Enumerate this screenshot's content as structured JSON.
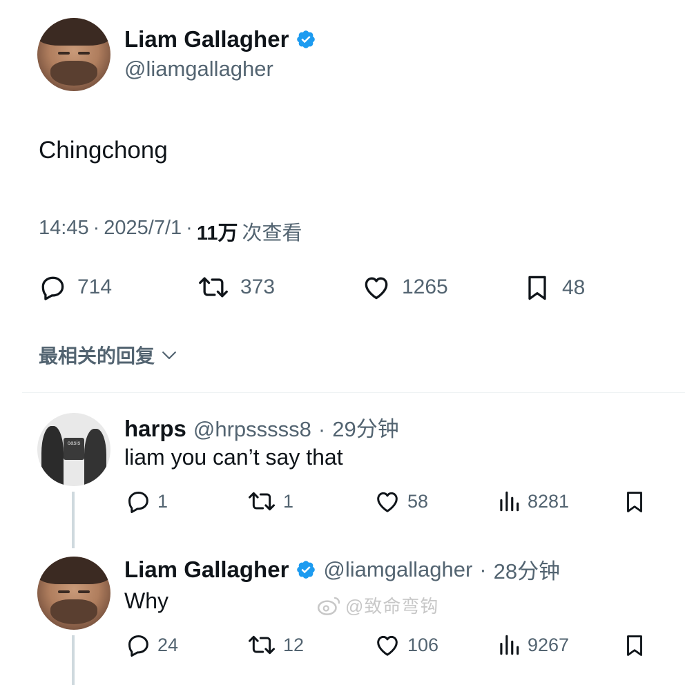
{
  "main_tweet": {
    "author_name": "Liam Gallagher",
    "handle": "@liamgallagher",
    "text": "Chingchong",
    "time": "14:45",
    "date": "2025/7/1",
    "views_count": "11万",
    "views_suffix": "次查看",
    "sep": "·",
    "replies": "714",
    "retweets": "373",
    "likes": "1265",
    "bookmarks": "48"
  },
  "sort_label": "最相关的回复",
  "replies": [
    {
      "author_name": "harps",
      "handle": "@hrpsssss8",
      "time": "29分钟",
      "text": "liam you can’t say that",
      "replies": "1",
      "retweets": "1",
      "likes": "58",
      "views": "8281",
      "avatar_text": "oasis"
    },
    {
      "author_name": "Liam Gallagher",
      "handle": "@liamgallagher",
      "time": "28分钟",
      "text": "Why",
      "replies": "24",
      "retweets": "12",
      "likes": "106",
      "views": "9267"
    }
  ],
  "watermark": "@致命弯钩",
  "colors": {
    "verified": "#1d9bf0",
    "text": "#0f1419",
    "secondary": "#536471"
  },
  "icons": [
    "verified-icon",
    "reply-icon",
    "retweet-icon",
    "like-icon",
    "bookmark-icon",
    "views-icon",
    "chevron-down-icon",
    "weibo-icon"
  ]
}
